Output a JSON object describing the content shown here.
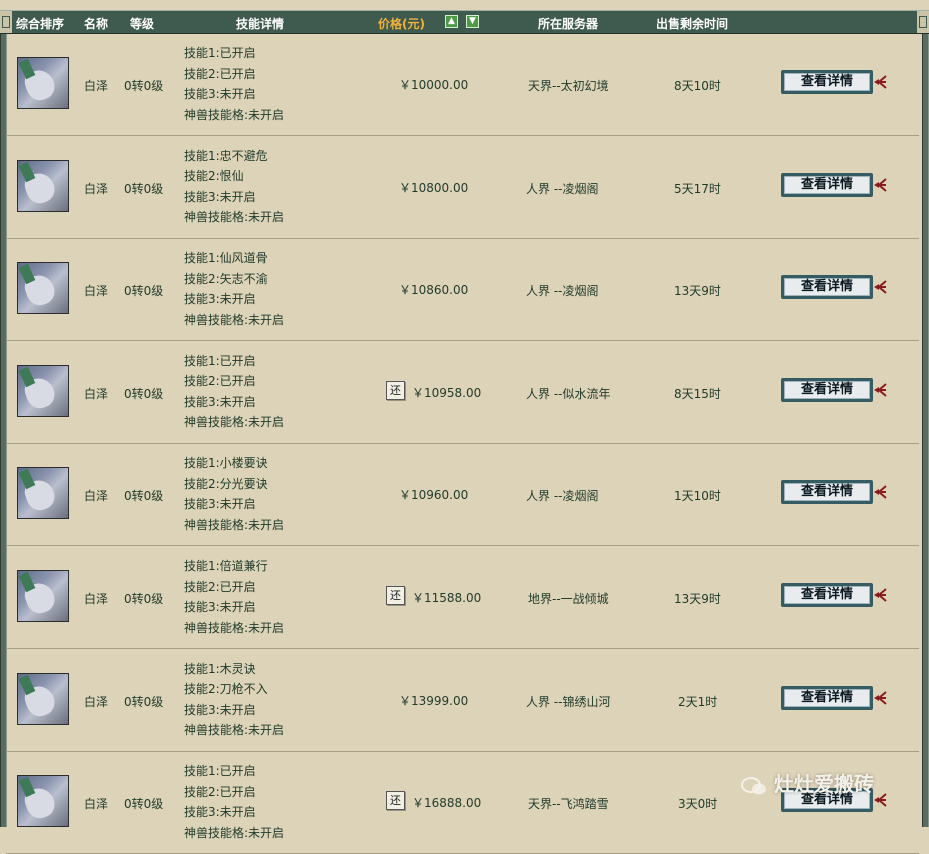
{
  "header": {
    "rank": "综合排序",
    "name": "名称",
    "level": "等级",
    "skills": "技能详情",
    "price": "价格(元)",
    "server": "所在服务器",
    "time_left": "出售剩余时间",
    "sort_up_icon": "arrow-up-icon",
    "sort_down_icon": "arrow-down-icon"
  },
  "detail_button_label": "查看详情",
  "refund_label": "还",
  "watermark": "灶灶爱搬砖",
  "rows": [
    {
      "name": "白泽",
      "level": "0转0级",
      "skill1": "技能1:已开启",
      "skill2": "技能2:已开启",
      "skill3": "技能3:未开启",
      "beast": "神兽技能格:未开启",
      "price": "￥10000.00",
      "refund": false,
      "server": "天界--太初幻境",
      "time": "8天10时"
    },
    {
      "name": "白泽",
      "level": "0转0级",
      "skill1": "技能1:忠不避危",
      "skill2": "技能2:恨仙",
      "skill3": "技能3:未开启",
      "beast": "神兽技能格:未开启",
      "price": "￥10800.00",
      "refund": false,
      "server": "人界 --凌烟阁",
      "time": "5天17时"
    },
    {
      "name": "白泽",
      "level": "0转0级",
      "skill1": "技能1:仙风道骨",
      "skill2": "技能2:矢志不渝",
      "skill3": "技能3:未开启",
      "beast": "神兽技能格:未开启",
      "price": "￥10860.00",
      "refund": false,
      "server": "人界 --凌烟阁",
      "time": "13天9时"
    },
    {
      "name": "白泽",
      "level": "0转0级",
      "skill1": "技能1:已开启",
      "skill2": "技能2:已开启",
      "skill3": "技能3:未开启",
      "beast": "神兽技能格:未开启",
      "price": "￥10958.00",
      "refund": true,
      "server": "人界 --似水流年",
      "time": "8天15时"
    },
    {
      "name": "白泽",
      "level": "0转0级",
      "skill1": "技能1:小楼要诀",
      "skill2": "技能2:分光要诀",
      "skill3": "技能3:未开启",
      "beast": "神兽技能格:未开启",
      "price": "￥10960.00",
      "refund": false,
      "server": "人界 --凌烟阁",
      "time": "1天10时"
    },
    {
      "name": "白泽",
      "level": "0转0级",
      "skill1": "技能1:倍道兼行",
      "skill2": "技能2:已开启",
      "skill3": "技能3:未开启",
      "beast": "神兽技能格:未开启",
      "price": "￥11588.00",
      "refund": true,
      "server": "地界--一战倾城",
      "time": "13天9时"
    },
    {
      "name": "白泽",
      "level": "0转0级",
      "skill1": "技能1:木灵诀",
      "skill2": "技能2:刀枪不入",
      "skill3": "技能3:未开启",
      "beast": "神兽技能格:未开启",
      "price": "￥13999.00",
      "refund": false,
      "server": "人界 --锦绣山河",
      "time": "2天1时"
    },
    {
      "name": "白泽",
      "level": "0转0级",
      "skill1": "技能1:已开启",
      "skill2": "技能2:已开启",
      "skill3": "技能3:未开启",
      "beast": "神兽技能格:未开启",
      "price": "￥16888.00",
      "refund": true,
      "server": "天界--飞鸿踏雪",
      "time": "3天0时"
    }
  ]
}
